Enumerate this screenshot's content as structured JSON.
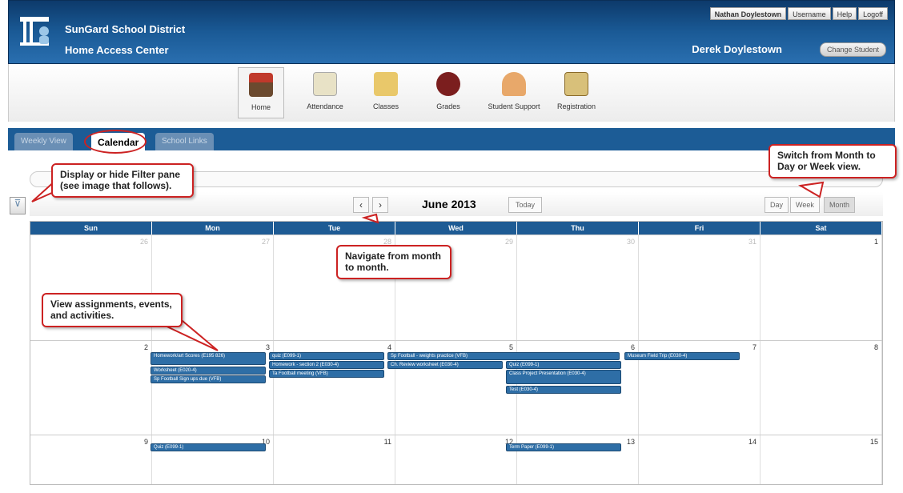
{
  "header": {
    "district": "SunGard School District",
    "app_name": "Home Access Center",
    "top_links": [
      "Nathan Doylestown",
      "Username",
      "Help",
      "Logoff"
    ],
    "student_name": "Derek Doylestown",
    "change_student": "Change Student"
  },
  "nav": [
    "Home",
    "Attendance",
    "Classes",
    "Grades",
    "Student Support",
    "Registration"
  ],
  "tabs": [
    "Weekly View",
    "Calendar",
    "School Links"
  ],
  "calendar": {
    "month_title": "June 2013",
    "today": "Today",
    "views": [
      "Day",
      "Week",
      "Month"
    ],
    "day_headers": [
      "Sun",
      "Mon",
      "Tue",
      "Wed",
      "Thu",
      "Fri",
      "Sat"
    ],
    "weeks": [
      [
        "26",
        "27",
        "28",
        "29",
        "30",
        "31",
        "1"
      ],
      [
        "2",
        "3",
        "4",
        "5",
        "6",
        "7",
        "8"
      ],
      [
        "9",
        "10",
        "11",
        "12",
        "13",
        "14",
        "15"
      ]
    ],
    "events": {
      "mon3": [
        "Homework/art Scores (E195 826)",
        "Worksheet (E020-4)",
        "Sp Football Sign ups due (VFB)"
      ],
      "tue4": [
        "quiz (E099-1)",
        "Homework - section 2 (E030-4)",
        "Ta Football meeting (VFB)"
      ],
      "wed5": [
        "Sp Football - weights practice (VFB)",
        "Ch. Review worksheet (E030-4)"
      ],
      "thu6": [
        "Quiz (E099-1)",
        "Class Project Presentation (E030-4)",
        "Test (E030-4)"
      ],
      "fri7": [
        "Museum Field Trip (E030-4)"
      ],
      "mon10": [
        "Quiz (E099-1)"
      ],
      "thu13": [
        "Term Paper (E099-1)"
      ]
    }
  },
  "callouts": {
    "filter": "Display or hide Filter pane (see image that follows).",
    "view_switch": "Switch from Month to Day or Week view.",
    "navigate": "Navigate from month to month.",
    "assignments": "View assignments, events, and activities."
  }
}
